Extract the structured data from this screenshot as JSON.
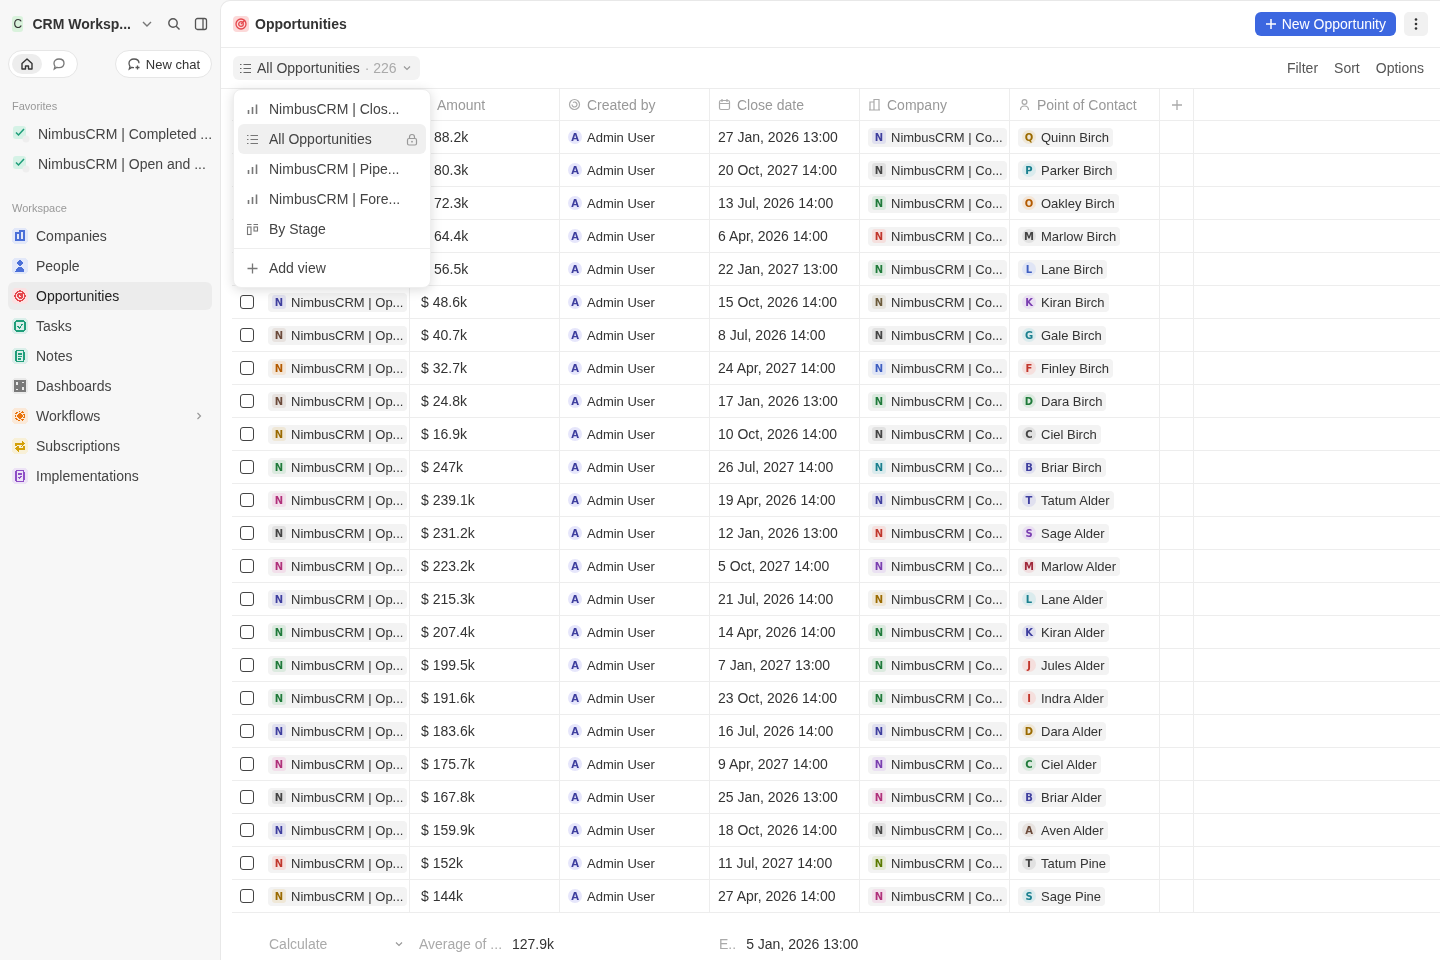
{
  "workspace": {
    "badge": "C",
    "name": "CRM Worksp..."
  },
  "mode_toggle": [
    {
      "kind": "home",
      "selected": true
    },
    {
      "kind": "chat",
      "selected": false
    }
  ],
  "new_chat": "New chat",
  "favorites": {
    "title": "Favorites",
    "items": [
      "NimbusCRM | Completed ...",
      "NimbusCRM | Open and ..."
    ]
  },
  "workspace_nav": {
    "title": "Workspace",
    "items": [
      {
        "label": "Companies",
        "color": "#4a6fd8",
        "selected": false,
        "expandable": false
      },
      {
        "label": "People",
        "color": "#4a6fd8",
        "selected": false,
        "expandable": false
      },
      {
        "label": "Opportunities",
        "color": "#e5484d",
        "selected": true,
        "expandable": false
      },
      {
        "label": "Tasks",
        "color": "#1f9e7a",
        "selected": false,
        "expandable": false
      },
      {
        "label": "Notes",
        "color": "#1f9e7a",
        "selected": false,
        "expandable": false
      },
      {
        "label": "Dashboards",
        "color": "#7a7a7a",
        "selected": false,
        "expandable": false
      },
      {
        "label": "Workflows",
        "color": "#e8730c",
        "selected": false,
        "expandable": true
      },
      {
        "label": "Subscriptions",
        "color": "#d4a007",
        "selected": false,
        "expandable": false
      },
      {
        "label": "Implementations",
        "color": "#8e4ec6",
        "selected": false,
        "expandable": false
      }
    ]
  },
  "page": {
    "title": "Opportunities",
    "primary_button": "New Opportunity"
  },
  "view_selector": {
    "label": "All Opportunities",
    "count": "· 226"
  },
  "view_actions": [
    "Filter",
    "Sort",
    "Options"
  ],
  "views_menu": {
    "items": [
      {
        "kind": "numbers",
        "label": "NimbusCRM | Clos...",
        "selected": false,
        "locked": false
      },
      {
        "kind": "list",
        "label": "All Opportunities",
        "selected": true,
        "locked": true
      },
      {
        "kind": "numbers",
        "label": "NimbusCRM | Pipe...",
        "selected": false,
        "locked": false
      },
      {
        "kind": "numbers",
        "label": "NimbusCRM | Fore...",
        "selected": false,
        "locked": false
      },
      {
        "kind": "kanban",
        "label": "By Stage",
        "selected": false,
        "locked": false
      }
    ],
    "add": "Add view"
  },
  "table": {
    "columns": [
      {
        "kind": "amount",
        "label": "Amount"
      },
      {
        "kind": "user",
        "label": "Created by"
      },
      {
        "kind": "date",
        "label": "Close date"
      },
      {
        "kind": "company",
        "label": "Company"
      },
      {
        "kind": "person",
        "label": "Point of Contact"
      }
    ],
    "rows": [
      {
        "amount": "88.2k",
        "creator": {
          "initial": "A",
          "name": "Admin User"
        },
        "close": "27 Jan, 2026 13:00",
        "company": {
          "initial": "N",
          "name": "NimbusCRM | Co...",
          "color": "#3e3e9e"
        },
        "contact": {
          "initial": "Q",
          "name": "Quinn Birch",
          "color": "#9a6a00"
        }
      },
      {
        "amount": "80.3k",
        "creator": {
          "initial": "A",
          "name": "Admin User"
        },
        "close": "20 Oct, 2027 14:00",
        "company": {
          "initial": "N",
          "name": "NimbusCRM | Co...",
          "color": "#444444"
        },
        "contact": {
          "initial": "P",
          "name": "Parker Birch",
          "color": "#1a7f8e"
        }
      },
      {
        "amount": "72.3k",
        "creator": {
          "initial": "A",
          "name": "Admin User"
        },
        "close": "13 Jul, 2026 14:00",
        "company": {
          "initial": "N",
          "name": "NimbusCRM | Co...",
          "color": "#1f7a3a"
        },
        "contact": {
          "initial": "O",
          "name": "Oakley Birch",
          "color": "#b35a00"
        }
      },
      {
        "amount": "64.4k",
        "creator": {
          "initial": "A",
          "name": "Admin User"
        },
        "close": "6 Apr, 2026 14:00",
        "company": {
          "initial": "N",
          "name": "NimbusCRM | Co...",
          "color": "#c0362c"
        },
        "contact": {
          "initial": "M",
          "name": "Marlow Birch",
          "color": "#444444"
        }
      },
      {
        "amount": "56.5k",
        "creator": {
          "initial": "A",
          "name": "Admin User"
        },
        "close": "22 Jan, 2027 13:00",
        "company": {
          "initial": "N",
          "name": "NimbusCRM | Co...",
          "color": "#1f7a3a"
        },
        "contact": {
          "initial": "L",
          "name": "Lane Birch",
          "color": "#3e5ec0"
        }
      },
      {
        "checked": false,
        "name": {
          "initial": "N",
          "text": "NimbusCRM | Op...",
          "color": "#3e3e9e"
        },
        "amount": "$ 48.6k",
        "creator": {
          "initial": "A",
          "name": "Admin User"
        },
        "close": "15 Oct, 2026 14:00",
        "company": {
          "initial": "N",
          "name": "NimbusCRM | Co...",
          "color": "#6b5a3a"
        },
        "contact": {
          "initial": "K",
          "name": "Kiran Birch",
          "color": "#7a3eb0"
        }
      },
      {
        "checked": false,
        "name": {
          "initial": "N",
          "text": "NimbusCRM | Op...",
          "color": "#6b4a3a"
        },
        "amount": "$ 40.7k",
        "creator": {
          "initial": "A",
          "name": "Admin User"
        },
        "close": "8 Jul, 2026 14:00",
        "company": {
          "initial": "N",
          "name": "NimbusCRM | Co...",
          "color": "#444444"
        },
        "contact": {
          "initial": "G",
          "name": "Gale Birch",
          "color": "#1a7f8e"
        }
      },
      {
        "checked": false,
        "name": {
          "initial": "N",
          "text": "NimbusCRM | Op...",
          "color": "#b35a00"
        },
        "amount": "$ 32.7k",
        "creator": {
          "initial": "A",
          "name": "Admin User"
        },
        "close": "24 Apr, 2027 14:00",
        "company": {
          "initial": "N",
          "name": "NimbusCRM | Co...",
          "color": "#3e5ec0"
        },
        "contact": {
          "initial": "F",
          "name": "Finley Birch",
          "color": "#c0362c"
        }
      },
      {
        "checked": false,
        "name": {
          "initial": "N",
          "text": "NimbusCRM | Op...",
          "color": "#6b4a3a"
        },
        "amount": "$ 24.8k",
        "creator": {
          "initial": "A",
          "name": "Admin User"
        },
        "close": "17 Jan, 2026 13:00",
        "company": {
          "initial": "N",
          "name": "NimbusCRM | Co...",
          "color": "#1f7a3a"
        },
        "contact": {
          "initial": "D",
          "name": "Dara Birch",
          "color": "#1f7a3a"
        }
      },
      {
        "checked": false,
        "name": {
          "initial": "N",
          "text": "NimbusCRM | Op...",
          "color": "#9a6a00"
        },
        "amount": "$ 16.9k",
        "creator": {
          "initial": "A",
          "name": "Admin User"
        },
        "close": "10 Oct, 2026 14:00",
        "company": {
          "initial": "N",
          "name": "NimbusCRM | Co...",
          "color": "#444444"
        },
        "contact": {
          "initial": "C",
          "name": "Ciel Birch",
          "color": "#444444"
        }
      },
      {
        "checked": false,
        "name": {
          "initial": "N",
          "text": "NimbusCRM | Op...",
          "color": "#1f7a3a"
        },
        "amount": "$ 247k",
        "creator": {
          "initial": "A",
          "name": "Admin User"
        },
        "close": "26 Jul, 2027 14:00",
        "company": {
          "initial": "N",
          "name": "NimbusCRM | Co...",
          "color": "#1a7f8e"
        },
        "contact": {
          "initial": "B",
          "name": "Briar Birch",
          "color": "#3e3e9e"
        }
      },
      {
        "checked": false,
        "name": {
          "initial": "N",
          "text": "NimbusCRM | Op...",
          "color": "#b0307a"
        },
        "amount": "$ 239.1k",
        "creator": {
          "initial": "A",
          "name": "Admin User"
        },
        "close": "19 Apr, 2026 14:00",
        "company": {
          "initial": "N",
          "name": "NimbusCRM | Co...",
          "color": "#3e3e9e"
        },
        "contact": {
          "initial": "T",
          "name": "Tatum Alder",
          "color": "#3e3e9e"
        }
      },
      {
        "checked": false,
        "name": {
          "initial": "N",
          "text": "NimbusCRM | Op...",
          "color": "#444444"
        },
        "amount": "$ 231.2k",
        "creator": {
          "initial": "A",
          "name": "Admin User"
        },
        "close": "12 Jan, 2026 13:00",
        "company": {
          "initial": "N",
          "name": "NimbusCRM | Co...",
          "color": "#c0362c"
        },
        "contact": {
          "initial": "S",
          "name": "Sage Alder",
          "color": "#7a3eb0"
        }
      },
      {
        "checked": false,
        "name": {
          "initial": "N",
          "text": "NimbusCRM | Op...",
          "color": "#b0307a"
        },
        "amount": "$ 223.2k",
        "creator": {
          "initial": "A",
          "name": "Admin User"
        },
        "close": "5 Oct, 2027 14:00",
        "company": {
          "initial": "N",
          "name": "NimbusCRM | Co...",
          "color": "#7a3eb0"
        },
        "contact": {
          "initial": "M",
          "name": "Marlow Alder",
          "color": "#a0283a"
        }
      },
      {
        "checked": false,
        "name": {
          "initial": "N",
          "text": "NimbusCRM | Op...",
          "color": "#3e3e9e"
        },
        "amount": "$ 215.3k",
        "creator": {
          "initial": "A",
          "name": "Admin User"
        },
        "close": "21 Jul, 2026 14:00",
        "company": {
          "initial": "N",
          "name": "NimbusCRM | Co...",
          "color": "#9a6a00"
        },
        "contact": {
          "initial": "L",
          "name": "Lane Alder",
          "color": "#1a7f8e"
        }
      },
      {
        "checked": false,
        "name": {
          "initial": "N",
          "text": "NimbusCRM | Op...",
          "color": "#1f7a3a"
        },
        "amount": "$ 207.4k",
        "creator": {
          "initial": "A",
          "name": "Admin User"
        },
        "close": "14 Apr, 2026 14:00",
        "company": {
          "initial": "N",
          "name": "NimbusCRM | Co...",
          "color": "#1f7a3a"
        },
        "contact": {
          "initial": "K",
          "name": "Kiran Alder",
          "color": "#3e3e9e"
        }
      },
      {
        "checked": false,
        "name": {
          "initial": "N",
          "text": "NimbusCRM | Op...",
          "color": "#1f7a3a"
        },
        "amount": "$ 199.5k",
        "creator": {
          "initial": "A",
          "name": "Admin User"
        },
        "close": "7 Jan, 2027 13:00",
        "company": {
          "initial": "N",
          "name": "NimbusCRM | Co...",
          "color": "#1f7a3a"
        },
        "contact": {
          "initial": "J",
          "name": "Jules Alder",
          "color": "#c0362c"
        }
      },
      {
        "checked": false,
        "name": {
          "initial": "N",
          "text": "NimbusCRM | Op...",
          "color": "#1f7a3a"
        },
        "amount": "$ 191.6k",
        "creator": {
          "initial": "A",
          "name": "Admin User"
        },
        "close": "23 Oct, 2026 14:00",
        "company": {
          "initial": "N",
          "name": "NimbusCRM | Co...",
          "color": "#1f7a3a"
        },
        "contact": {
          "initial": "I",
          "name": "Indra Alder",
          "color": "#c0362c"
        }
      },
      {
        "checked": false,
        "name": {
          "initial": "N",
          "text": "NimbusCRM | Op...",
          "color": "#3e3e9e"
        },
        "amount": "$ 183.6k",
        "creator": {
          "initial": "A",
          "name": "Admin User"
        },
        "close": "16 Jul, 2026 14:00",
        "company": {
          "initial": "N",
          "name": "NimbusCRM | Co...",
          "color": "#3e3e9e"
        },
        "contact": {
          "initial": "D",
          "name": "Dara Alder",
          "color": "#9a6a00"
        }
      },
      {
        "checked": false,
        "name": {
          "initial": "N",
          "text": "NimbusCRM | Op...",
          "color": "#b0307a"
        },
        "amount": "$ 175.7k",
        "creator": {
          "initial": "A",
          "name": "Admin User"
        },
        "close": "9 Apr, 2027 14:00",
        "company": {
          "initial": "N",
          "name": "NimbusCRM | Co...",
          "color": "#7a3eb0"
        },
        "contact": {
          "initial": "C",
          "name": "Ciel Alder",
          "color": "#1f7a3a"
        }
      },
      {
        "checked": false,
        "name": {
          "initial": "N",
          "text": "NimbusCRM | Op...",
          "color": "#444444"
        },
        "amount": "$ 167.8k",
        "creator": {
          "initial": "A",
          "name": "Admin User"
        },
        "close": "25 Jan, 2026 13:00",
        "company": {
          "initial": "N",
          "name": "NimbusCRM | Co...",
          "color": "#b0307a"
        },
        "contact": {
          "initial": "B",
          "name": "Briar Alder",
          "color": "#3e3e9e"
        }
      },
      {
        "checked": false,
        "name": {
          "initial": "N",
          "text": "NimbusCRM | Op...",
          "color": "#3e3e9e"
        },
        "amount": "$ 159.9k",
        "creator": {
          "initial": "A",
          "name": "Admin User"
        },
        "close": "18 Oct, 2026 14:00",
        "company": {
          "initial": "N",
          "name": "NimbusCRM | Co...",
          "color": "#444444"
        },
        "contact": {
          "initial": "A",
          "name": "Aven Alder",
          "color": "#6b4a3a"
        }
      },
      {
        "checked": false,
        "name": {
          "initial": "N",
          "text": "NimbusCRM | Op...",
          "color": "#c0362c"
        },
        "amount": "$ 152k",
        "creator": {
          "initial": "A",
          "name": "Admin User"
        },
        "close": "11 Jul, 2027 14:00",
        "company": {
          "initial": "N",
          "name": "NimbusCRM | Co...",
          "color": "#5a7a00"
        },
        "contact": {
          "initial": "T",
          "name": "Tatum Pine",
          "color": "#444444"
        }
      },
      {
        "checked": false,
        "name": {
          "initial": "N",
          "text": "NimbusCRM | Op...",
          "color": "#9a6a00"
        },
        "amount": "$ 144k",
        "creator": {
          "initial": "A",
          "name": "Admin User"
        },
        "close": "27 Apr, 2026 14:00",
        "company": {
          "initial": "N",
          "name": "NimbusCRM | Co...",
          "color": "#b0307a"
        },
        "contact": {
          "initial": "S",
          "name": "Sage Pine",
          "color": "#1a7f8e"
        }
      }
    ]
  },
  "footer": {
    "calculate": "Calculate",
    "aggregate_label": "Average of ...",
    "aggregate_value": "127.9k",
    "date_label": "E..",
    "date_value": "5 Jan, 2026 13:00"
  }
}
